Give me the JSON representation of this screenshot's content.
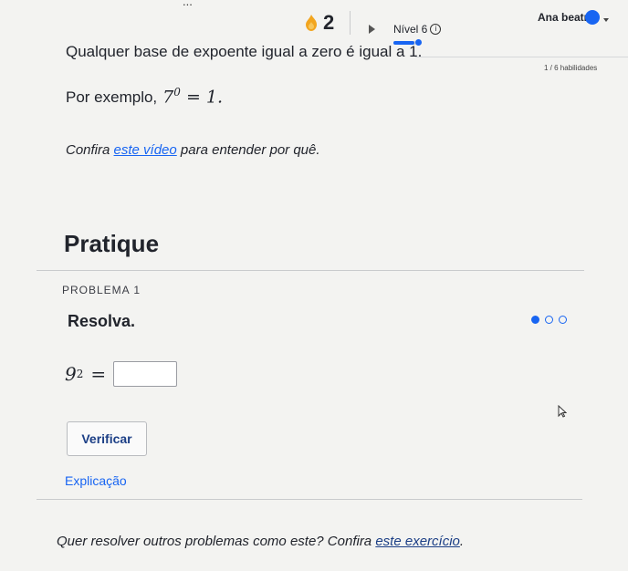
{
  "header": {
    "truncated_title": "...",
    "streak_count": "2",
    "level_label": "Nível 6",
    "level_progress": 0.75,
    "username": "Ana beatriz",
    "skills": "1 / 6 habilidades"
  },
  "lesson": {
    "rule": "Qualquer base de expoente igual a zero é igual a 1.",
    "example_prefix": "Por exemplo,",
    "example_base": "7",
    "example_exp": "0",
    "example_rest": " = 1.",
    "video_prefix": "Confira ",
    "video_link": "este vídeo",
    "video_suffix": " para entender por quê."
  },
  "practice": {
    "heading": "Pratique",
    "problem_label": "PROBLEMA 1",
    "prompt": "Resolva.",
    "eq_base": "9",
    "eq_exp": "2",
    "eq_equals": "=",
    "answer_value": "",
    "check_button": "Verificar",
    "explanation_link": "Explicação"
  },
  "footer": {
    "prefix": "Quer resolver outros problemas como este? Confira ",
    "link": "este exercício",
    "suffix": "."
  },
  "colors": {
    "accent": "#1865f2",
    "streak": "#f2a51f"
  }
}
